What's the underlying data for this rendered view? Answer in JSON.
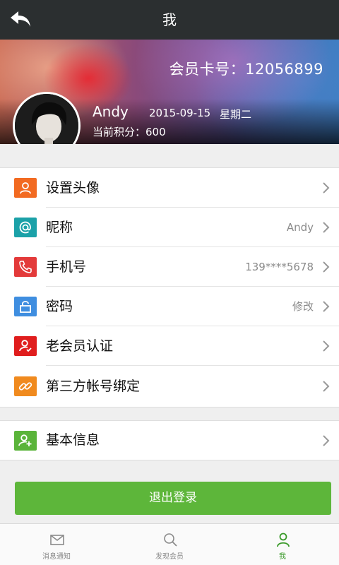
{
  "header": {
    "title": "我"
  },
  "profile": {
    "card_number_label": "会员卡号：12056899",
    "name": "Andy",
    "date": "2015-09-15",
    "weekday": "星期二",
    "points_label": "当前积分：600"
  },
  "menu": {
    "items": [
      {
        "label": "设置头像",
        "value": "",
        "icon": "user-icon",
        "color": "#f26a21"
      },
      {
        "label": "昵称",
        "value": "Andy",
        "icon": "at-icon",
        "color": "#1ba1a8"
      },
      {
        "label": "手机号",
        "value": "139****5678",
        "icon": "phone-icon",
        "color": "#e33a3a"
      },
      {
        "label": "密码",
        "value": "修改",
        "icon": "lock-icon",
        "color": "#3f8ee0"
      },
      {
        "label": "老会员认证",
        "value": "",
        "icon": "user-check-icon",
        "color": "#e01d1d"
      },
      {
        "label": "第三方帐号绑定",
        "value": "",
        "icon": "link-icon",
        "color": "#f08a1e"
      }
    ],
    "basic": {
      "label": "基本信息",
      "icon": "user-add-icon",
      "color": "#5ab43a"
    }
  },
  "actions": {
    "logout_label": "退出登录"
  },
  "bottom_nav": {
    "items": [
      {
        "label": "消息通知",
        "icon": "mail-icon",
        "active": false
      },
      {
        "label": "发现会员",
        "icon": "search-icon",
        "active": false
      },
      {
        "label": "我",
        "icon": "person-icon",
        "active": true
      }
    ]
  },
  "colors": {
    "topbar": "#2b2f30",
    "accent": "#5db63a",
    "background": "#efefef"
  }
}
